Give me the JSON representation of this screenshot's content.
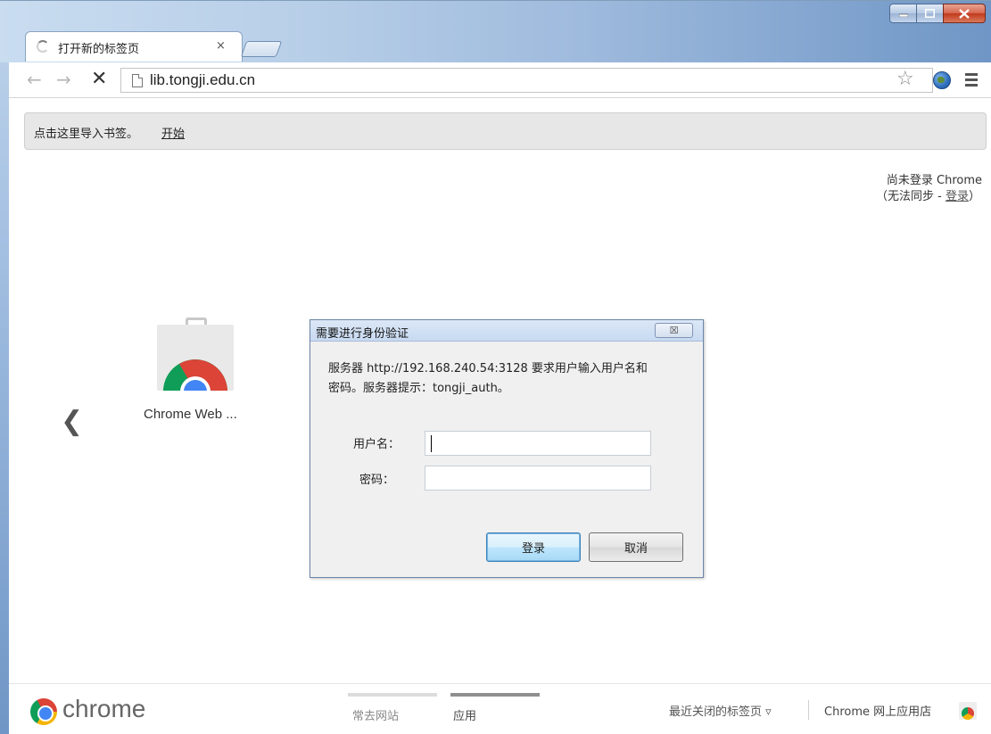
{
  "tab": {
    "title": "打开新的标签页",
    "close": "×"
  },
  "toolbar": {
    "back": "←",
    "forward": "→",
    "stop": "✕",
    "url": "lib.tongji.edu.cn",
    "star": "☆"
  },
  "bookmarks_bar": {
    "text": "点击这里导入书签。",
    "link": "开始"
  },
  "signin": {
    "line1": "尚未登录 Chrome",
    "line2_prefix": "（无法同步 - ",
    "line2_link": "登录",
    "line2_suffix": "）"
  },
  "apps": {
    "tile_label": "Chrome Web ...",
    "prev": "❮"
  },
  "dialog": {
    "title": "需要进行身份验证",
    "close": "☒",
    "message_line1": "服务器 http://192.168.240.54:3128 要求用户输入用户名和",
    "message_line2": "密码。服务器提示：tongji_auth。",
    "username_label": "用户名：",
    "password_label": "密码：",
    "username_value": "",
    "password_value": "",
    "ok": "登录",
    "cancel": "取消"
  },
  "bottom_bar": {
    "brand": "chrome",
    "page1": "常去网站",
    "page2": "应用",
    "recent": "最近关闭的标签页 ▿",
    "store": "Chrome 网上应用店"
  }
}
